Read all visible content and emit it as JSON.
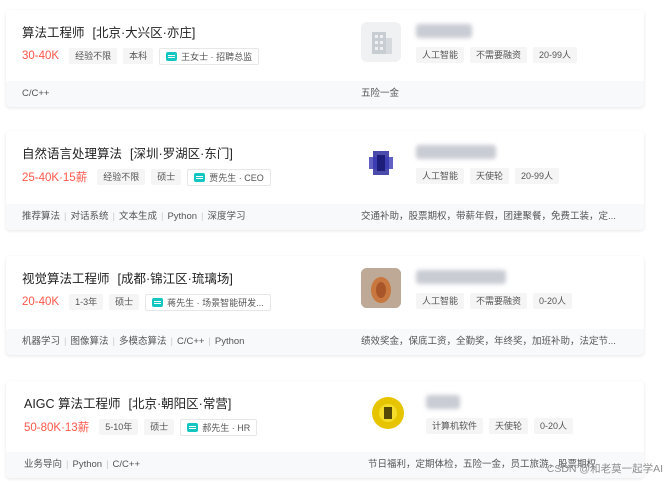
{
  "jobs": [
    {
      "title": "算法工程师",
      "location": "[北京·大兴区·亦庄]",
      "salary": "30-40K",
      "tags": [
        "经验不限",
        "本科"
      ],
      "recruiter": "王女士 · 招聘总监",
      "company_tags": [
        "人工智能",
        "不需要融资",
        "20-99人"
      ],
      "skills": [
        "C/C++"
      ],
      "benefits": "五险一金",
      "logo_icon": "building-icon",
      "logo_color": "#cfd3da"
    },
    {
      "title": "自然语言处理算法",
      "location": "[深圳·罗湖区·东门]",
      "salary": "25-40K·15薪",
      "tags": [
        "经验不限",
        "硕士"
      ],
      "recruiter": "贾先生 · CEO",
      "company_tags": [
        "人工智能",
        "天使轮",
        "20-99人"
      ],
      "skills": [
        "推荐算法",
        "对话系统",
        "文本生成",
        "Python",
        "深度学习"
      ],
      "benefits": "交通补助，股票期权，带薪年假，团建聚餐，免费工装，定...",
      "logo_icon": "company-logo-icon",
      "logo_color": "#2c2c9e"
    },
    {
      "title": "视觉算法工程师",
      "location": "[成都·锦江区·琉璃场]",
      "salary": "20-40K",
      "tags": [
        "1-3年",
        "硕士"
      ],
      "recruiter": "蒋先生 · 场景智能研发...",
      "company_tags": [
        "人工智能",
        "不需要融资",
        "0-20人"
      ],
      "skills": [
        "机器学习",
        "图像算法",
        "多模态算法",
        "C/C++",
        "Python"
      ],
      "benefits": "绩效奖金，保底工资，全勤奖，年终奖，加班补助，法定节...",
      "logo_icon": "company-logo-icon",
      "logo_color": "#c98a5c"
    },
    {
      "title": "AIGC 算法工程师",
      "location": "[北京·朝阳区·常营]",
      "salary": "50-80K·13薪",
      "tags": [
        "5-10年",
        "硕士"
      ],
      "recruiter": "郝先生 · HR",
      "company_tags": [
        "计算机软件",
        "天使轮",
        "0-20人"
      ],
      "skills": [
        "业务导向",
        "Python",
        "C/C++"
      ],
      "benefits": "节日福利，定期体检，五险一金，员工旅游，股票期权",
      "logo_icon": "company-logo-icon",
      "logo_color": "#e6c400"
    }
  ],
  "watermark": "CSDN @和老莫一起学AI",
  "colors": {
    "salary": "#fe574a",
    "chat_icon": "#14c6c1"
  }
}
